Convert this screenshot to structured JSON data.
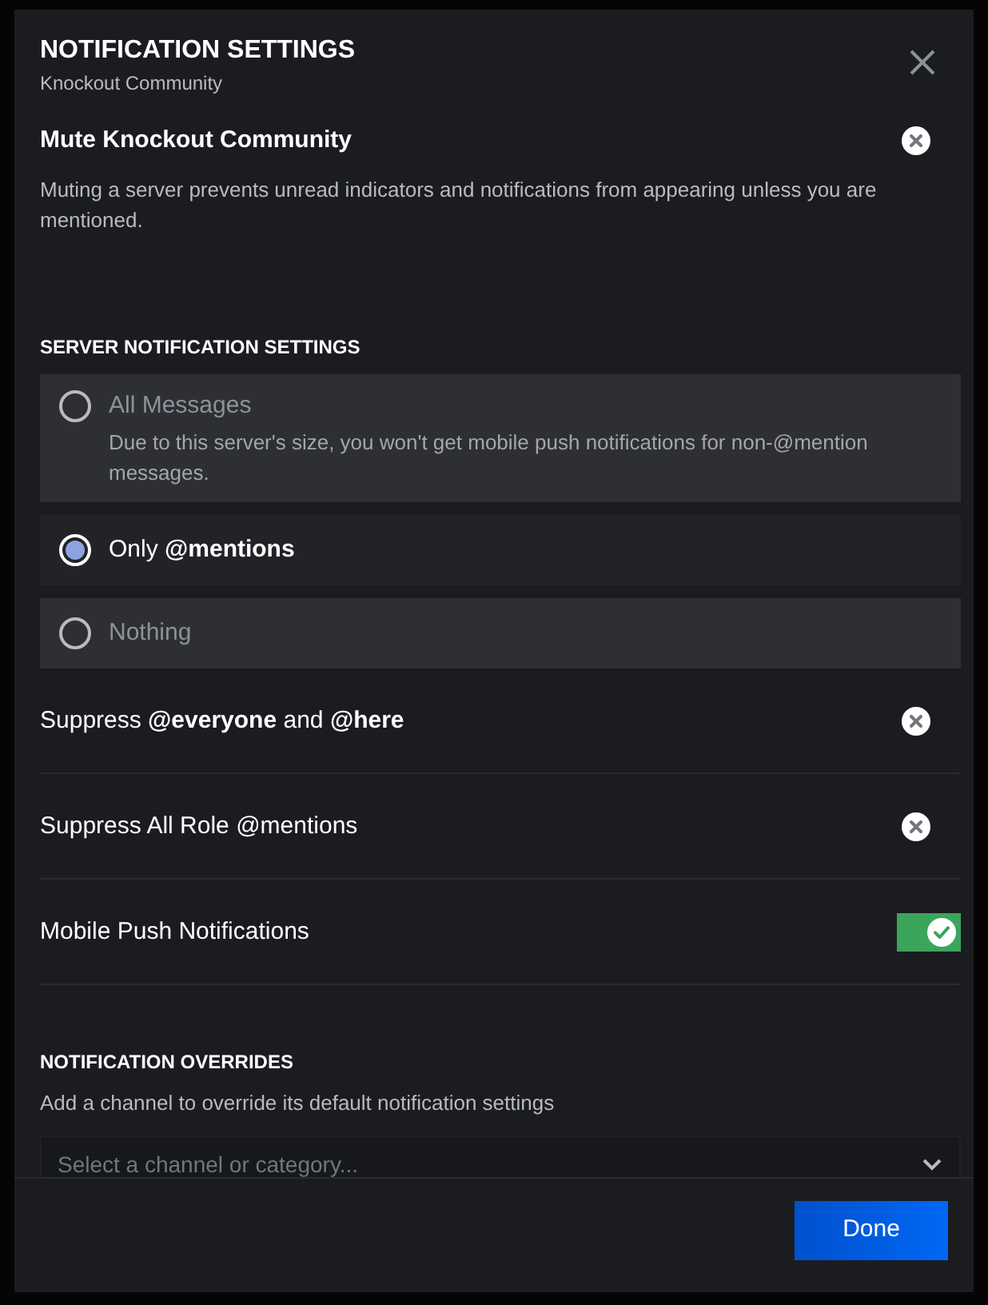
{
  "modal": {
    "title": "NOTIFICATION SETTINGS",
    "subtitle": "Knockout Community"
  },
  "mute": {
    "label": "Mute Knockout Community",
    "on": false,
    "description": "Muting a server prevents unread indicators and notifications from appearing unless you are mentioned."
  },
  "server_notifications": {
    "heading": "SERVER NOTIFICATION SETTINGS",
    "options": [
      {
        "label": "All Messages",
        "description": "Due to this server's size, you won't get mobile push notifications for non-@mention messages.",
        "selected": false
      },
      {
        "label": "Only **@mentions**",
        "selected": true
      },
      {
        "label": "Nothing",
        "selected": false
      }
    ]
  },
  "toggles": [
    {
      "label": "Suppress **@everyone** and **@here**",
      "on": false
    },
    {
      "label": "Suppress All Role @mentions",
      "on": false
    },
    {
      "label": "Mobile Push Notifications",
      "on": true
    }
  ],
  "overrides": {
    "heading": "NOTIFICATION OVERRIDES",
    "description": "Add a channel to override its default notification settings",
    "select": {
      "placeholder": "Select a channel or category..."
    }
  },
  "footer": {
    "buttons": [
      "Done"
    ]
  }
}
